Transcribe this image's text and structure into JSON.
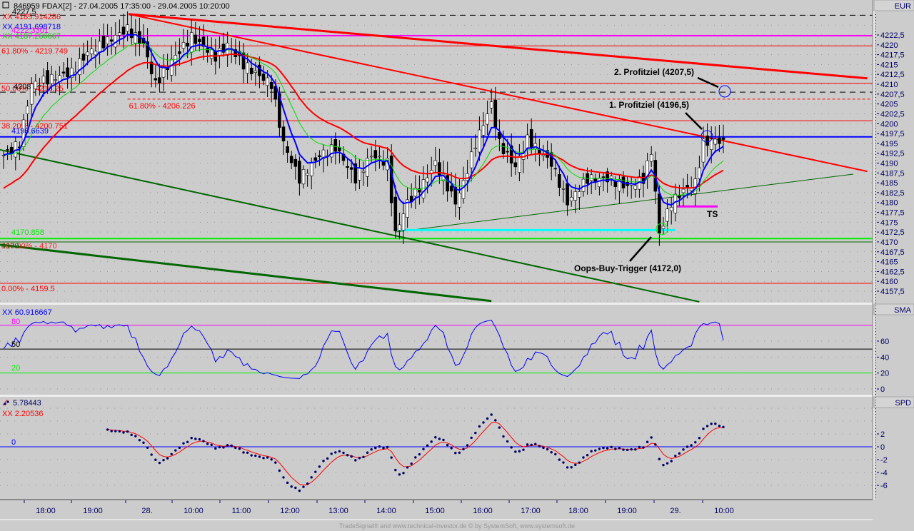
{
  "header": {
    "title": "846959  FDAX[2] - 27.04.2005 17:35:00 - 29.04.2005 10:20:00"
  },
  "footer": {
    "credit": "TradeSignal® and www.technical-investor.de © by SystemSoft, www.systemsoft.de"
  },
  "colors": {
    "bg": "#cccccc",
    "red": "#ff0000",
    "blue": "#0000ff",
    "green": "#00ee00",
    "darkgreen": "#006600",
    "magenta": "#ff00ff",
    "cyan": "#00ffff",
    "navy": "#000066"
  },
  "chart_data": [
    {
      "type": "candlestick",
      "title": "846959 FDAX[2] - 27.04.2005 17:35:00 - 29.04.2005 10:20:00",
      "currency_label": "EUR",
      "ylim": [
        4155,
        4230
      ],
      "yticks": [
        "4222,5",
        "4220",
        "4217,5",
        "4215",
        "4212,5",
        "4210",
        "4207,5",
        "4205",
        "4202,5",
        "4200",
        "4197,5",
        "4195",
        "4192,5",
        "4190",
        "4187,5",
        "4185",
        "4182,5",
        "4180",
        "4177,5",
        "4175",
        "4172,5",
        "4170",
        "4167,5",
        "4165",
        "4162,5",
        "4160",
        "4157,5"
      ],
      "ytick_values": [
        4222.5,
        4220,
        4217.5,
        4215,
        4212.5,
        4210,
        4207.5,
        4205,
        4202.5,
        4200,
        4197.5,
        4195,
        4192.5,
        4190,
        4187.5,
        4185,
        4182.5,
        4180,
        4177.5,
        4175,
        4172.5,
        4170,
        4167.5,
        4165,
        4162.5,
        4160,
        4157.5
      ],
      "bar_interval_minutes": 5,
      "close_anchors": [
        [
          0,
          4192
        ],
        [
          4,
          4195
        ],
        [
          7,
          4210
        ],
        [
          17,
          4213
        ],
        [
          21,
          4218
        ],
        [
          31,
          4224
        ],
        [
          35,
          4220
        ],
        [
          38,
          4210
        ],
        [
          42,
          4216
        ],
        [
          47,
          4222
        ],
        [
          53,
          4217
        ],
        [
          56,
          4220
        ],
        [
          60,
          4215
        ],
        [
          67,
          4210
        ],
        [
          70,
          4195
        ],
        [
          74,
          4186
        ],
        [
          79,
          4192
        ],
        [
          83,
          4194
        ],
        [
          88,
          4186
        ],
        [
          92,
          4192
        ],
        [
          96,
          4190
        ],
        [
          98,
          4172
        ],
        [
          101,
          4180
        ],
        [
          105,
          4185
        ],
        [
          108,
          4190
        ],
        [
          113,
          4180
        ],
        [
          115,
          4185
        ],
        [
          118,
          4195
        ],
        [
          122,
          4205
        ],
        [
          124,
          4195
        ],
        [
          128,
          4189
        ],
        [
          131,
          4196
        ],
        [
          137,
          4190
        ],
        [
          141,
          4180
        ],
        [
          146,
          4186
        ],
        [
          151,
          4186
        ],
        [
          156,
          4184
        ],
        [
          160,
          4186
        ],
        [
          162,
          4193
        ],
        [
          164,
          4172
        ],
        [
          167,
          4180
        ],
        [
          170,
          4183
        ],
        [
          173,
          4185
        ],
        [
          175,
          4195
        ],
        [
          178,
          4196
        ],
        [
          180,
          4195
        ]
      ],
      "legend": [
        {
          "label": "XX 4185.914286",
          "color": "#ff0000"
        },
        {
          "label": "XX 4191.698718",
          "color": "#0000ff"
        },
        {
          "label": "XX 4187.266667",
          "color": "#00cc00"
        }
      ],
      "overlay_labels": {
        "high": "4227,5",
        "magenta_level": "4222.3301",
        "level_4208": "4208",
        "blue_level": "4196.6639",
        "green_level": "4170.858",
        "dkgreen_level": "4170",
        "fib_0_start": "100.00% - 4170"
      },
      "horizontal_levels": [
        {
          "label": "61.80% - 4219.749",
          "value": 4219.749,
          "color": "#ff0000"
        },
        {
          "label": "50.00% - 4210.25",
          "value": 4210.25,
          "color": "#ff0000"
        },
        {
          "label": "38.20% - 4200.751",
          "value": 4200.751,
          "color": "#ff0000"
        },
        {
          "label": "0.00% - 4159.5",
          "value": 4159.5,
          "color": "#ff0000"
        },
        {
          "label": "61.80% - 4206.226",
          "value": 4206.226,
          "color": "#ff0000",
          "dashed": true,
          "start_bar": 31
        }
      ],
      "trendlines": [
        {
          "from": [
            31.25,
            4227.8
          ],
          "to": [
            216,
            4211.5
          ],
          "color": "#ff0000",
          "weight": "thick"
        },
        {
          "from": [
            31.25,
            4227.8
          ],
          "to": [
            216,
            4187.9
          ],
          "color": "#ff0000",
          "weight": "medium"
        },
        {
          "from": [
            -1,
            4169.3
          ],
          "to": [
            122,
            4155
          ],
          "color": "#006600",
          "weight": "thick"
        },
        {
          "from": [
            -1,
            4193.4
          ],
          "to": [
            174,
            4154.8
          ],
          "color": "#006600",
          "weight": "medium"
        },
        {
          "from": [
            98,
            4172.5
          ],
          "to": [
            212.5,
            4187.2
          ],
          "color": "#006600",
          "weight": "thin"
        },
        {
          "from": [
            98,
            4173
          ],
          "to": [
            168,
            4173
          ],
          "color": "#00ffff",
          "weight": "thick"
        },
        {
          "from": [
            168.4,
            4179
          ],
          "to": [
            178.6,
            4179
          ],
          "color": "#ff00ff",
          "weight": "thick"
        }
      ],
      "annotations": [
        {
          "text": "2. Profitziel (4207,5)",
          "price": 4207.5
        },
        {
          "text": "1. Profitziel (4196,5)",
          "price": 4196.5
        },
        {
          "text": "Oops-Buy-Trigger (4172,0)",
          "price": 4172.0
        },
        {
          "text": "TS",
          "price": 4179
        }
      ],
      "xticks": [
        "18:00",
        "19:00",
        "28.",
        "10:00",
        "11:00",
        "12:00",
        "13:00",
        "14:00",
        "15:00",
        "16:00",
        "17:00",
        "18:00",
        "19:00",
        "29.",
        "10:00"
      ]
    },
    {
      "type": "line",
      "name": "SMA",
      "panel_label": "SMA",
      "legend": "XX 60.916667",
      "last_value": 60.916667,
      "levels": [
        {
          "label": "80",
          "value": 80,
          "color": "#ff00ff"
        },
        {
          "label": "50",
          "value": 50,
          "color": "#000000"
        },
        {
          "label": "20",
          "value": 20,
          "color": "#00ee00"
        }
      ],
      "yticks": [
        "60",
        "40",
        "20",
        "0"
      ],
      "ytick_values": [
        60,
        40,
        20,
        0
      ]
    },
    {
      "type": "scatter+line",
      "name": "SPD",
      "panel_label": "SPD",
      "legend_dots": "5.78443",
      "legend_line": "XX 2.20536",
      "zero_label": "0",
      "yticks": [
        "2",
        "0",
        "-2",
        "-4",
        "-6"
      ],
      "ytick_values": [
        2,
        0,
        -2,
        -4,
        -6
      ]
    }
  ]
}
